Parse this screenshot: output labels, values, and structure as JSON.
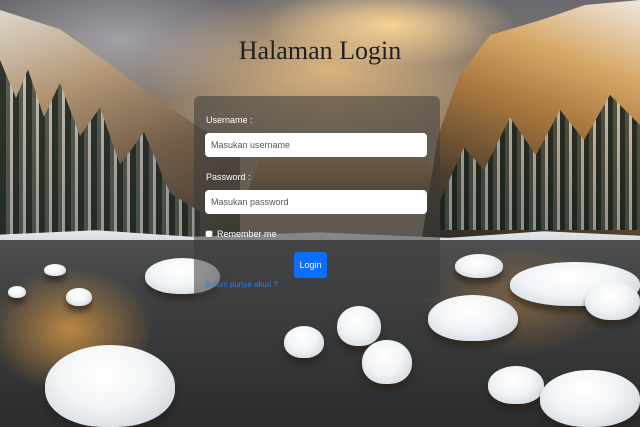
{
  "page": {
    "title": "Halaman Login"
  },
  "form": {
    "username_label": "Username :",
    "username_placeholder": "Masukan username",
    "password_label": "Password :",
    "password_placeholder": "Masukan password",
    "remember_label": "Remember me",
    "remember_checked": false,
    "login_button": "Login",
    "register_link": "Belum punya akun ?"
  },
  "colors": {
    "primary_button": "#0d6efd",
    "link": "#2f7df2",
    "card_overlay": "rgba(60,60,60,0.55)"
  }
}
